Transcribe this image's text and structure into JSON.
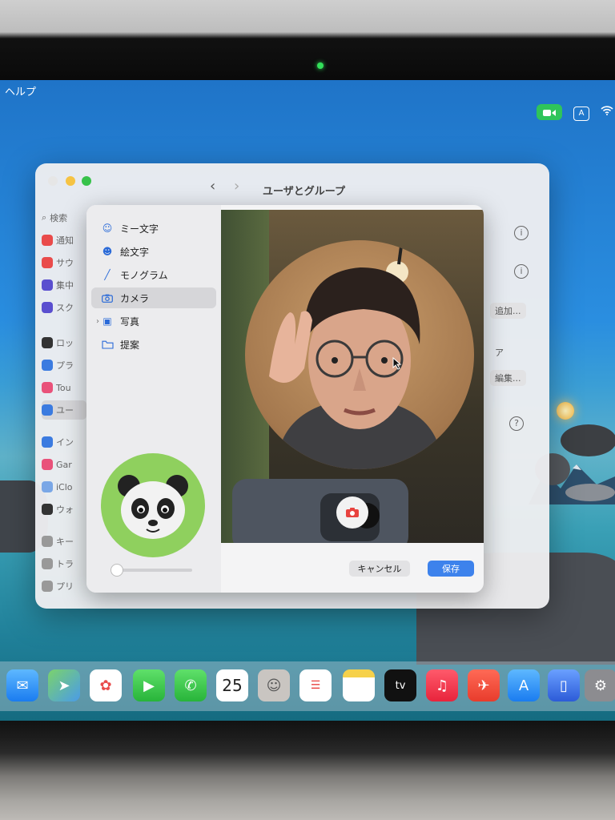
{
  "menubar": {
    "help": "ヘルプ",
    "input_indicator": "A"
  },
  "settings_window": {
    "title": "ユーザとグループ",
    "search_placeholder": "検索",
    "sidebar_fragments": [
      "通知",
      "サウ",
      "集中",
      "スク",
      "ロッ",
      "プラ",
      "Tou",
      "ユー",
      "イン",
      "Gar",
      "iClo",
      "ウォ",
      "キー",
      "トラ",
      "プリ"
    ],
    "right_fragments": [
      "追加...",
      "ア",
      "編集...",
      "?"
    ]
  },
  "picker": {
    "items": [
      {
        "label": "ミー文字",
        "icon": "memoji-icon"
      },
      {
        "label": "絵文字",
        "icon": "emoji-icon"
      },
      {
        "label": "モノグラム",
        "icon": "pencil-icon"
      },
      {
        "label": "カメラ",
        "icon": "camera-icon",
        "selected": true
      },
      {
        "label": "写真",
        "icon": "photos-icon",
        "expandable": true
      },
      {
        "label": "提案",
        "icon": "folder-icon"
      }
    ],
    "cancel_label": "キャンセル",
    "save_label": "保存",
    "zoom_level": 0.1
  },
  "dock": {
    "calendar_day": "25",
    "calendar_month": "",
    "tv_label": "tv",
    "apps": [
      "mail-icon",
      "maps-icon",
      "photos-icon",
      "facetime-icon",
      "phone-icon",
      "calendar-icon",
      "contacts-icon",
      "reminders-icon",
      "notes-icon",
      "tv-icon",
      "music-icon",
      "launchpad-icon",
      "app-store-icon",
      "iphone-mirroring-icon",
      "system-settings-icon"
    ]
  },
  "colors": {
    "accent": "#3d82ec",
    "facetime_green": "#2fc45a",
    "avatar_bg": "#8fd05e"
  }
}
